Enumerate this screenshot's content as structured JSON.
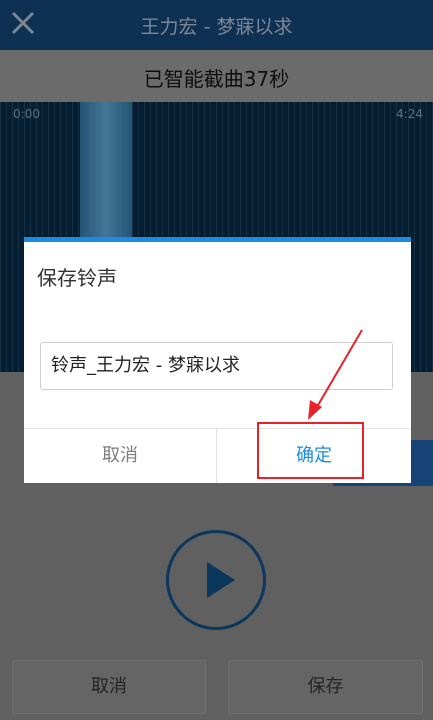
{
  "titlebar": {
    "title": "王力宏 - 梦寐以求"
  },
  "subtitle": "已智能截曲37秒",
  "waveform": {
    "start_time": "0:00",
    "end_time": "4:24"
  },
  "bottom": {
    "cancel_label": "取消",
    "save_label": "保存"
  },
  "dialog": {
    "title": "保存铃声",
    "input_value": "铃声_王力宏 - 梦寐以求",
    "cancel_label": "取消",
    "ok_label": "确定"
  },
  "colors": {
    "accent": "#1d8be0",
    "highlight": "#e8222a",
    "titlebar": "#10385f"
  }
}
